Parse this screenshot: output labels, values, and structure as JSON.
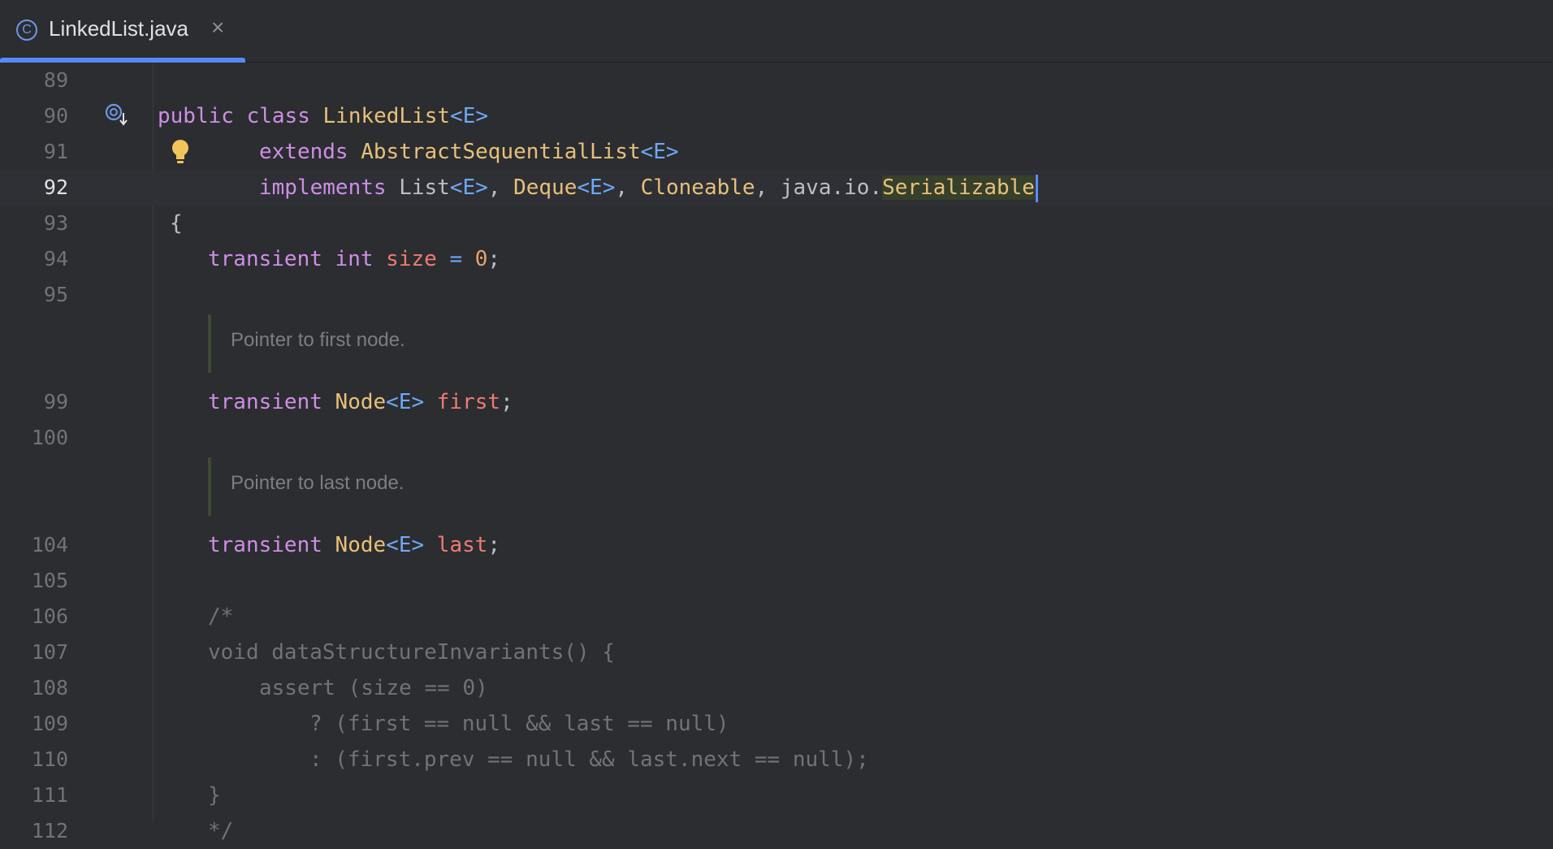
{
  "tab": {
    "title": "LinkedList.java",
    "close": "×",
    "file_icon": "class-c-icon"
  },
  "lines": [
    {
      "n": "89"
    },
    {
      "n": "90"
    },
    {
      "n": "91"
    },
    {
      "n": "92"
    },
    {
      "n": "93"
    },
    {
      "n": "94"
    },
    {
      "n": "95"
    },
    {
      "n": "99"
    },
    {
      "n": "100"
    },
    {
      "n": "104"
    },
    {
      "n": "105"
    },
    {
      "n": "106"
    },
    {
      "n": "107"
    },
    {
      "n": "108"
    },
    {
      "n": "109"
    },
    {
      "n": "110"
    },
    {
      "n": "111"
    },
    {
      "n": "112"
    }
  ],
  "code": {
    "l90": {
      "public": "public",
      "class": "class",
      "name": "LinkedList",
      "tp": "<E>"
    },
    "l91": {
      "extends": "extends",
      "super": "AbstractSequentialList",
      "tp": "<E>"
    },
    "l92": {
      "implements": "implements",
      "i1": "List",
      "tp1": "<E>",
      "c1": ", ",
      "i2": "Deque",
      "tp2": "<E>",
      "c2": ", ",
      "i3": "Cloneable",
      "c3": ", ",
      "pkg": "java.io.",
      "i4": "Serializable"
    },
    "l93": "{",
    "l94": {
      "transient": "transient",
      "int": "int",
      "field": "size",
      "eq": " = ",
      "val": "0",
      "semi": ";"
    },
    "doc1": "Pointer to first node.",
    "l99": {
      "transient": "transient",
      "type": "Node",
      "tp": "<E>",
      "field": "first",
      "semi": ";"
    },
    "doc2": "Pointer to last node.",
    "l104": {
      "transient": "transient",
      "type": "Node",
      "tp": "<E>",
      "field": "last",
      "semi": ";"
    },
    "l106": "/*",
    "l107": "void dataStructureInvariants() {",
    "l108": "assert (size == 0)",
    "l109": "? (first == null && last == null)",
    "l110": ": (first.prev == null && last.next == null);",
    "l111": "}",
    "l112": "*/"
  },
  "gutter": {
    "override_icon": "override-marker-icon",
    "intention_icon": "lightbulb-icon"
  },
  "colors": {
    "keyword": "#cf8ee6",
    "class": "#e8c07a",
    "type_param": "#6fa8f5",
    "field": "#ee7b72",
    "number": "#e4a46c",
    "comment": "#6f737a",
    "caret": "#5b8cf7"
  }
}
